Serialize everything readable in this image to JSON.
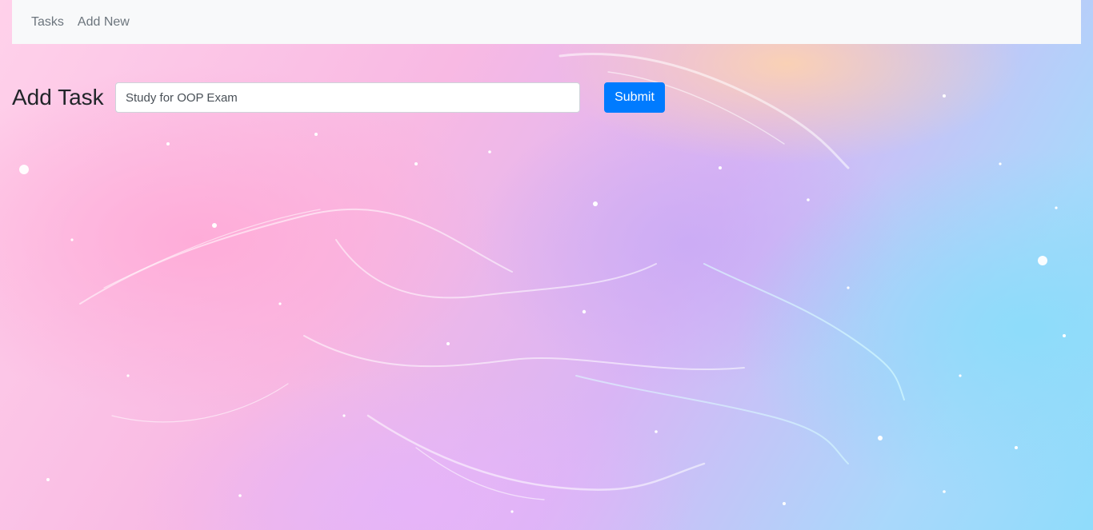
{
  "navbar": {
    "links": [
      {
        "label": "Tasks"
      },
      {
        "label": "Add New"
      }
    ]
  },
  "form": {
    "title": "Add Task",
    "task_input": {
      "value": "Study for OOP Exam"
    },
    "submit_label": "Submit"
  },
  "colors": {
    "primary": "#007bff",
    "navbar_bg": "#f8f9fa",
    "nav_link": "#6c757d",
    "title": "#212529"
  }
}
